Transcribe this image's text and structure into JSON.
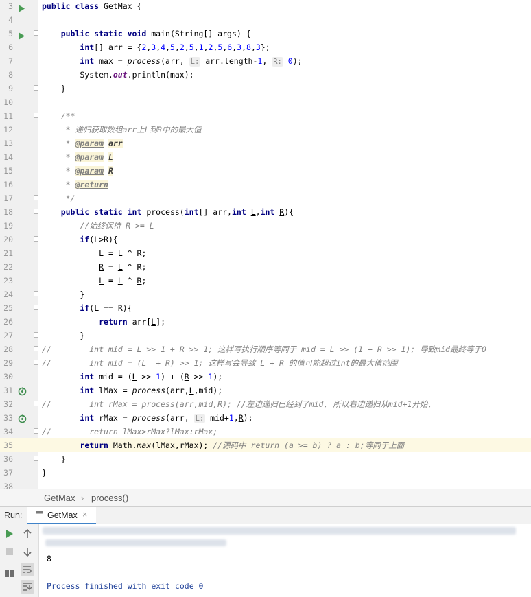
{
  "editor": {
    "lines": [
      {
        "n": "3",
        "code": "<span class=\"kw\">public class</span> GetMax {"
      },
      {
        "n": "4",
        "code": ""
      },
      {
        "n": "5",
        "code": "    <span class=\"kw\">public static void</span> main(String[] args) {"
      },
      {
        "n": "6",
        "code": "        <span class=\"kw\">int</span>[] arr = {<span class=\"num\">2</span>,<span class=\"num\">3</span>,<span class=\"num\">4</span>,<span class=\"num\">5</span>,<span class=\"num\">2</span>,<span class=\"num\">5</span>,<span class=\"num\">1</span>,<span class=\"num\">2</span>,<span class=\"num\">5</span>,<span class=\"num\">6</span>,<span class=\"num\">3</span>,<span class=\"num\">8</span>,<span class=\"num\">3</span>};"
      },
      {
        "n": "7",
        "code": "        <span class=\"kw\">int</span> max = <span class=\"it\">process</span>(arr, <span class=\"hint\">L:</span> arr.length-<span class=\"num\">1</span>, <span class=\"hint\">R:</span> <span class=\"num\">0</span>);"
      },
      {
        "n": "8",
        "code": "        System.<span class=\"sf\">out</span>.println(max);"
      },
      {
        "n": "9",
        "code": "    }"
      },
      {
        "n": "10",
        "code": ""
      },
      {
        "n": "11",
        "code": "    <span class=\"jd\">/**</span>"
      },
      {
        "n": "12",
        "code": "<span class=\"jd\">     * 递归获取数组arr上L到R中的最大值</span>"
      },
      {
        "n": "13",
        "code": "<span class=\"jd\">     * </span><span class=\"tag\">@param</span> <span class=\"tagv\">arr</span>"
      },
      {
        "n": "14",
        "code": "<span class=\"jd\">     * </span><span class=\"tag\">@param</span> <span class=\"tagv\">L</span>"
      },
      {
        "n": "15",
        "code": "<span class=\"jd\">     * </span><span class=\"tag\">@param</span> <span class=\"tagv\">R</span>"
      },
      {
        "n": "16",
        "code": "<span class=\"jd\">     * </span><span class=\"tag\">@return</span>"
      },
      {
        "n": "17",
        "code": "<span class=\"jd\">     */</span>"
      },
      {
        "n": "18",
        "code": "    <span class=\"kw\">public static int</span> process(<span class=\"kw\">int</span>[] arr,<span class=\"kw\">int</span> <span class=\"ul\">L</span>,<span class=\"kw\">int</span> <span class=\"ul\">R</span>){"
      },
      {
        "n": "19",
        "code": "        <span class=\"cmt\">//始终保持 R &gt;= L</span>"
      },
      {
        "n": "20",
        "code": "        <span class=\"kw\">if</span>(L&gt;R){"
      },
      {
        "n": "21",
        "code": "            <span class=\"ul\">L</span> = <span class=\"ul\">L</span> ^ R;"
      },
      {
        "n": "22",
        "code": "            <span class=\"ul\">R</span> = <span class=\"ul\">L</span> ^ R;"
      },
      {
        "n": "23",
        "code": "            <span class=\"ul\">L</span> = <span class=\"ul\">L</span> ^ <span class=\"ul\">R</span>;"
      },
      {
        "n": "24",
        "code": "        }"
      },
      {
        "n": "25",
        "code": "        <span class=\"kw\">if</span>(<span class=\"ul\">L</span> == <span class=\"ul\">R</span>){"
      },
      {
        "n": "26",
        "code": "            <span class=\"kw\">return</span> arr[<span class=\"ul\">L</span>];"
      },
      {
        "n": "27",
        "code": "        }"
      },
      {
        "n": "28",
        "code": "<span class=\"cmt\">//        int mid = L &gt;&gt; 1 + R &gt;&gt; 1; 这样写执行顺序等同于 mid = L &gt;&gt; (1 + R &gt;&gt; 1); 导致mid最终等于0</span>"
      },
      {
        "n": "29",
        "code": "<span class=\"cmt\">//        int mid = (L  + R) &gt;&gt; 1; 这样写会导致 L + R 的值可能超过int的最大值范围</span>"
      },
      {
        "n": "30",
        "code": "        <span class=\"kw\">int</span> mid = (<span class=\"ul\">L</span> &gt;&gt; <span class=\"num\">1</span>) + (<span class=\"ul\">R</span> &gt;&gt; <span class=\"num\">1</span>);"
      },
      {
        "n": "31",
        "code": "        <span class=\"kw\">int</span> lMax = <span class=\"it\">process</span>(arr,<span class=\"ul\">L</span>,mid);"
      },
      {
        "n": "32",
        "code": "<span class=\"cmt\">//        int rMax = process(arr,mid,R); //左边递归已经到了mid, 所以右边递归从mid+1开始,</span>"
      },
      {
        "n": "33",
        "code": "        <span class=\"kw\">int</span> rMax = <span class=\"it\">process</span>(arr, <span class=\"hint\">L:</span> mid+<span class=\"num\">1</span>,<span class=\"ul\">R</span>);"
      },
      {
        "n": "34",
        "code": "<span class=\"cmt\">//        return lMax&gt;rMax?lMax:rMax;</span>"
      },
      {
        "n": "35",
        "code": "        <span class=\"kw\">return</span> Math.<span class=\"it\">max</span>(lMax,rMax); <span class=\"cmt\">//源码中 return (a &gt;= b) ? a : b;等同于上面</span>"
      },
      {
        "n": "36",
        "code": "    }"
      },
      {
        "n": "37",
        "code": "}"
      },
      {
        "n": "38",
        "code": ""
      }
    ]
  },
  "breadcrumb": {
    "class_name": "GetMax",
    "sep": "›",
    "method_name": "process()"
  },
  "run": {
    "label": "Run:",
    "tab_label": "GetMax",
    "close": "×"
  },
  "console": {
    "output_value": "8",
    "finish_message": "Process finished with exit code 0"
  }
}
